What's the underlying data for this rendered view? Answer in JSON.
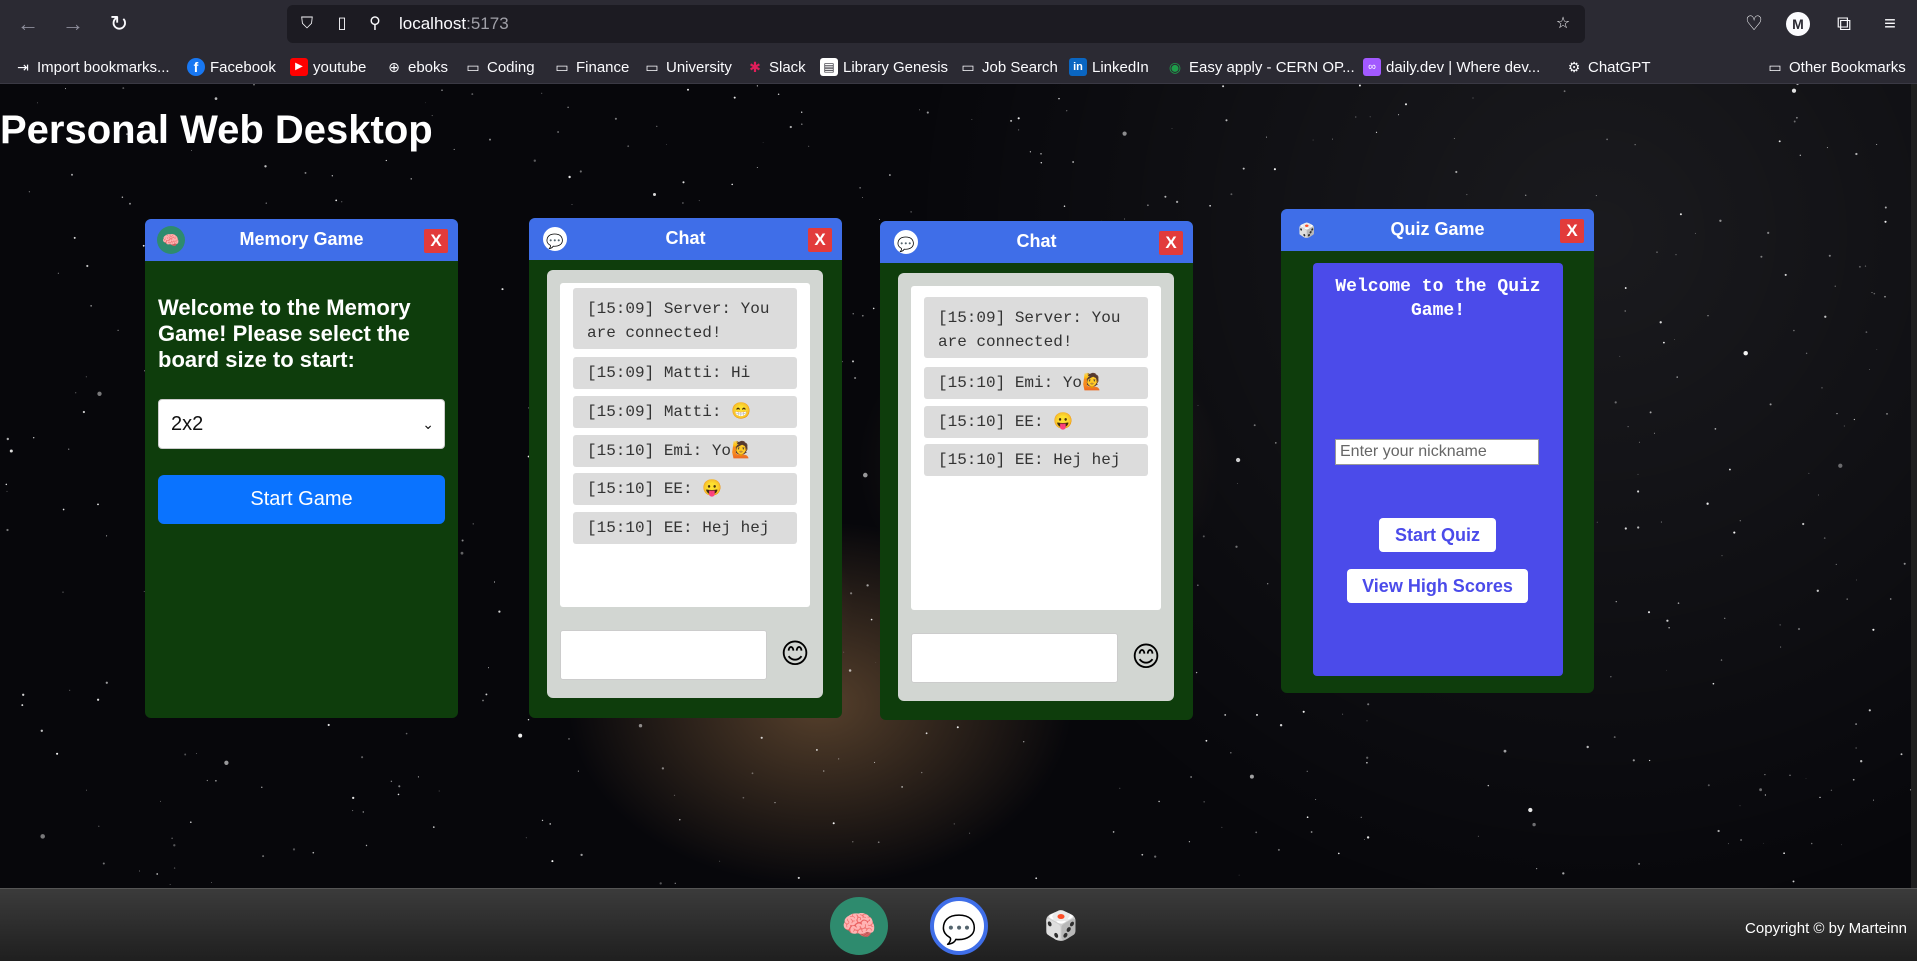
{
  "browser": {
    "url_host": "localhost",
    "url_port": ":5173",
    "avatar_letter": "M",
    "nav_icons": [
      "back-arrow-icon",
      "forward-arrow-icon",
      "reload-icon"
    ],
    "bookmarks": [
      {
        "label": "Import bookmarks...",
        "icon": "import-icon"
      },
      {
        "label": "Facebook",
        "icon": "facebook-icon",
        "color": "#1877f2"
      },
      {
        "label": "youtube",
        "icon": "youtube-icon",
        "color": "#ff0000"
      },
      {
        "label": "eboks",
        "icon": "globe-icon"
      },
      {
        "label": "Coding",
        "icon": "folder-icon"
      },
      {
        "label": "Finance",
        "icon": "folder-icon"
      },
      {
        "label": "University",
        "icon": "folder-icon"
      },
      {
        "label": "Slack",
        "icon": "slack-icon"
      },
      {
        "label": "Library Genesis",
        "icon": "book-icon"
      },
      {
        "label": "Job Search",
        "icon": "folder-icon"
      },
      {
        "label": "LinkedIn",
        "icon": "linkedin-icon",
        "color": "#0a66c2"
      },
      {
        "label": "Easy apply - CERN OP...",
        "icon": "cern-icon",
        "color": "#1e9e4a"
      },
      {
        "label": "daily.dev | Where dev...",
        "icon": "dailydev-icon",
        "color": "#a259ff"
      },
      {
        "label": "ChatGPT",
        "icon": "chatgpt-icon"
      }
    ],
    "other_bookmarks": "Other Bookmarks"
  },
  "desktop": {
    "title": "Personal Web Desktop"
  },
  "memory_window": {
    "title": "Memory Game",
    "close_label": "X",
    "icon": "brain-icon",
    "welcome": "Welcome to the Memory Game! Please select the board size to start:",
    "board_size_selected": "2x2",
    "start_label": "Start Game"
  },
  "chat_windows": [
    {
      "title": "Chat",
      "close_label": "X",
      "icon": "chat-bubble-icon",
      "messages": [
        "[15:09] Server: You are connected!",
        "[15:09] Matti: Hi",
        "[15:09] Matti: 😁",
        "[15:10] Emi: Yo🙋",
        "[15:10] EE: 😛",
        "[15:10] EE: Hej hej"
      ],
      "emoji": "😊"
    },
    {
      "title": "Chat",
      "close_label": "X",
      "icon": "chat-bubble-icon",
      "messages": [
        "[15:09] Server: You are connected!",
        "[15:10] Emi: Yo🙋",
        "[15:10] EE: 😛",
        "[15:10] EE: Hej hej"
      ],
      "emoji": "😊"
    }
  ],
  "quiz_window": {
    "title": "Quiz Game",
    "close_label": "X",
    "icon": "quiz-icon",
    "welcome": "Welcome to the Quiz Game!",
    "nickname_placeholder": "Enter your nickname",
    "start_label": "Start Quiz",
    "highscores_label": "View High Scores"
  },
  "taskbar": {
    "apps": [
      {
        "name": "memory-game-launcher",
        "icon": "brain-icon"
      },
      {
        "name": "chat-launcher",
        "icon": "chat-bubble-icon"
      },
      {
        "name": "quiz-launcher",
        "icon": "quiz-icon"
      }
    ],
    "copyright": "Copyright © by Marteinn"
  },
  "colors": {
    "window_header": "#3f6ee8",
    "window_body": "#0e3d0c",
    "close_button": "#e23b3b",
    "primary_button": "#0a73ff",
    "quiz_panel": "#4b4bea"
  }
}
